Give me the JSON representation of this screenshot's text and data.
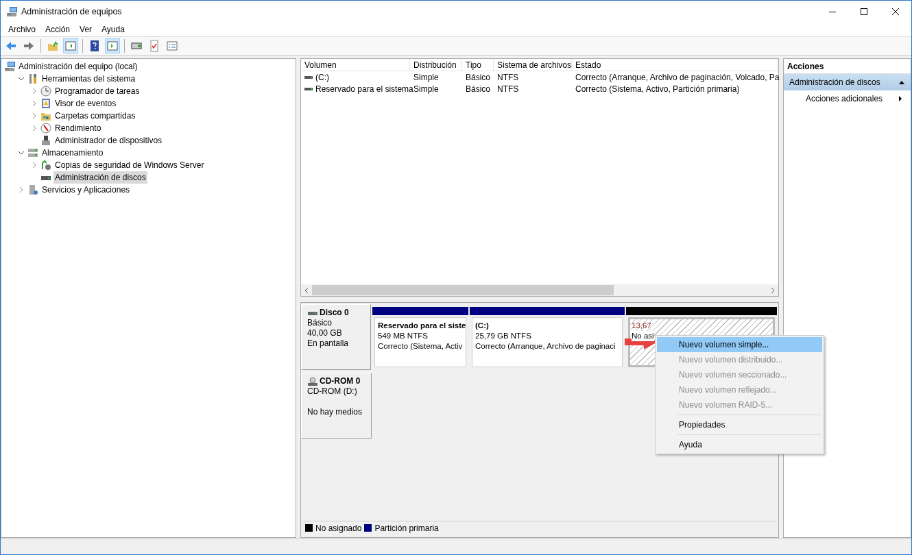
{
  "window": {
    "title": "Administración de equipos"
  },
  "menu": [
    "Archivo",
    "Acción",
    "Ver",
    "Ayuda"
  ],
  "tree": [
    {
      "label": "Administración del equipo (local)",
      "kind": "root",
      "selected": false,
      "children": [
        {
          "label": "Herramientas del sistema",
          "kind": "branch",
          "expanded": true,
          "selected": false,
          "children": [
            {
              "label": "Programador de tareas",
              "kind": "branch",
              "expanded": false,
              "selected": false
            },
            {
              "label": "Visor de eventos",
              "kind": "branch",
              "expanded": false,
              "selected": false
            },
            {
              "label": "Carpetas compartidas",
              "kind": "branch",
              "expanded": false,
              "selected": false
            },
            {
              "label": "Rendimiento",
              "kind": "branch",
              "expanded": false,
              "selected": false
            },
            {
              "label": "Administrador de dispositivos",
              "kind": "leaf",
              "selected": false
            }
          ]
        },
        {
          "label": "Almacenamiento",
          "kind": "branch",
          "expanded": true,
          "selected": false,
          "children": [
            {
              "label": "Copias de seguridad de Windows Server",
              "kind": "branch",
              "expanded": false,
              "selected": false
            },
            {
              "label": "Administración de discos",
              "kind": "leaf",
              "selected": true
            }
          ]
        },
        {
          "label": "Servicios y Aplicaciones",
          "kind": "branch",
          "expanded": false,
          "selected": false
        }
      ]
    }
  ],
  "volumes": {
    "columns": [
      "Volumen",
      "Distribución",
      "Tipo",
      "Sistema de archivos",
      "Estado"
    ],
    "rows": [
      [
        "(C:)",
        "Simple",
        "Básico",
        "NTFS",
        "Correcto (Arranque, Archivo de paginación, Volcado, Pa"
      ],
      [
        "Reservado para el sistema",
        "Simple",
        "Básico",
        "NTFS",
        "Correcto (Sistema, Activo, Partición primaria)"
      ]
    ]
  },
  "disks": [
    {
      "kind": "disk",
      "name": "Disco 0",
      "lines": [
        "Básico",
        "40,00 GB",
        "En pantalla"
      ],
      "partitions": [
        {
          "kind": "primary",
          "color": "#000080",
          "title": "Reservado para el siste",
          "lines": [
            "549 MB NTFS",
            "Correcto (Sistema, Activ"
          ]
        },
        {
          "kind": "primary",
          "color": "#000080",
          "title": "(C:)",
          "lines": [
            "25,79 GB NTFS",
            "Correcto (Arranque, Archivo de paginaci"
          ]
        },
        {
          "kind": "unallocated",
          "color": "#000000",
          "lines": [
            "13,67",
            "No asi"
          ]
        }
      ]
    },
    {
      "kind": "cdrom",
      "name": "CD-ROM 0",
      "lines": [
        "CD-ROM (D:)",
        "No hay medios"
      ]
    }
  ],
  "legend": [
    {
      "label": "No asignado",
      "color": "#000000"
    },
    {
      "label": "Partición primaria",
      "color": "#000080"
    }
  ],
  "actions": {
    "title": "Acciones",
    "section": "Administración de discos",
    "items": [
      "Acciones adicionales"
    ]
  },
  "context_menu": [
    {
      "kind": "item",
      "label": "Nuevo volumen simple...",
      "disabled": false,
      "selected": true
    },
    {
      "kind": "item",
      "label": "Nuevo volumen distribuido...",
      "disabled": true,
      "selected": false
    },
    {
      "kind": "item",
      "label": "Nuevo volumen seccionado...",
      "disabled": true,
      "selected": false
    },
    {
      "kind": "item",
      "label": "Nuevo volumen reflejado...",
      "disabled": true,
      "selected": false
    },
    {
      "kind": "item",
      "label": "Nuevo volumen RAID-5...",
      "disabled": true,
      "selected": false
    },
    {
      "kind": "separator"
    },
    {
      "kind": "item",
      "label": "Propiedades",
      "disabled": false,
      "selected": false
    },
    {
      "kind": "separator"
    },
    {
      "kind": "item",
      "label": "Ayuda",
      "disabled": false,
      "selected": false
    }
  ]
}
